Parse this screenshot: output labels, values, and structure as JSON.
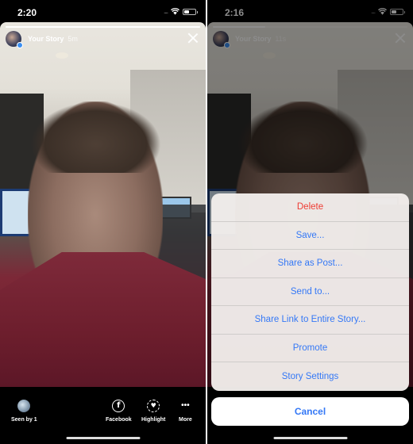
{
  "left": {
    "status": {
      "time": "2:20",
      "battery_level": 0.45
    },
    "story": {
      "title": "Your Story",
      "time_ago": "5m",
      "progress": 1.0
    },
    "bottom_bar": {
      "seen_by": "Seen by 1",
      "actions": [
        {
          "label": "Facebook",
          "icon": "facebook-icon",
          "glyph": "f"
        },
        {
          "label": "Highlight",
          "icon": "highlight-heart-icon",
          "glyph": "♥"
        },
        {
          "label": "More",
          "icon": "more-dots-icon",
          "glyph": "•••"
        }
      ]
    }
  },
  "right": {
    "status": {
      "time": "2:16",
      "battery_level": 0.45
    },
    "story": {
      "title": "Your Story",
      "time_ago": "11s",
      "progress": 0.27
    },
    "action_sheet": {
      "items": [
        {
          "label": "Delete",
          "style": "destructive"
        },
        {
          "label": "Save...",
          "style": "default"
        },
        {
          "label": "Share as Post...",
          "style": "default"
        },
        {
          "label": "Send to...",
          "style": "default"
        },
        {
          "label": "Share Link to Entire Story...",
          "style": "default"
        },
        {
          "label": "Promote",
          "style": "default"
        },
        {
          "label": "Story Settings",
          "style": "default"
        }
      ],
      "cancel_label": "Cancel"
    }
  },
  "colors": {
    "ios_blue": "#3478f6",
    "destructive_red": "#ee3c33",
    "badge_blue": "#3b8ff1"
  }
}
